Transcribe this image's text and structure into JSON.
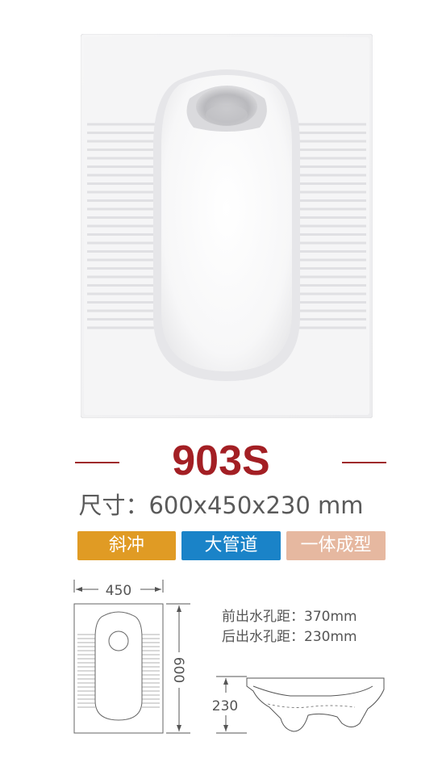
{
  "product": {
    "model": "903S",
    "size_text": "尺寸：600x450x230 mm",
    "tags": [
      "斜冲",
      "大管道",
      "一体成型"
    ],
    "front_outlet": "前出水孔距：370mm",
    "rear_outlet": "后出水孔距：230mm",
    "dim_width": "450",
    "dim_length": "600",
    "dim_height": "230"
  },
  "colors": {
    "model": "#a31f24",
    "tag_orange": "#e09b24",
    "tag_blue": "#1a83c8",
    "tag_pink": "#e6b8a0"
  }
}
